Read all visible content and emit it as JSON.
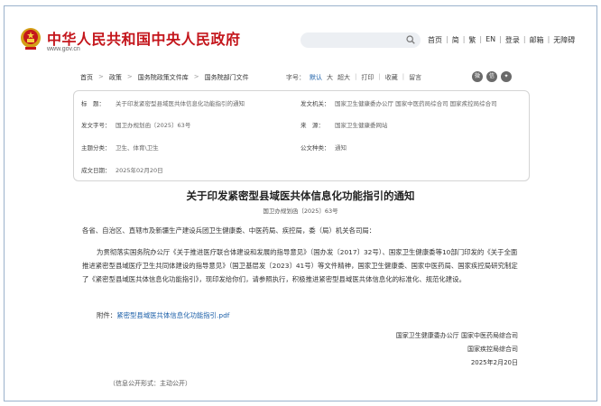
{
  "header": {
    "site_title": "中华人民共和国中央人民政府",
    "site_url": "www.gov.cn",
    "search": {
      "placeholder": ""
    },
    "nav": [
      "首页",
      "简",
      "繁",
      "EN",
      "登录",
      "邮箱",
      "无障碍"
    ]
  },
  "breadcrumb": {
    "items": [
      "首页",
      "政策",
      "国务院政策文件库",
      "国务院部门文件"
    ],
    "font_size_label": "字号：",
    "font_sizes": [
      "默认",
      "大",
      "超大"
    ],
    "print": "打印",
    "favorite": "收藏",
    "leave": "留言"
  },
  "meta": {
    "title_label": "标　题：",
    "title_value": "关于印发紧密型县域医共体信息化功能指引的通知",
    "issuer_label": "发文机关：",
    "issuer_value": "国家卫生健康委办公厅  国家中医药局综合司  国家疾控局综合司",
    "docno_label": "发文字号：",
    "docno_value": "国卫办规划函〔2025〕63号",
    "source_label": "来　源：",
    "source_value": "国家卫生健康委网站",
    "topic_label": "主题分类：",
    "topic_value": "卫生、体育\\卫生",
    "type_label": "公文种类：",
    "type_value": "通知",
    "date_label": "成文日期：",
    "date_value": "2025年02月20日"
  },
  "article": {
    "title": "关于印发紧密型县域医共体信息化功能指引的通知",
    "docno": "国卫办规划函〔2025〕63号",
    "salutation": "各省、自治区、直辖市及新疆生产建设兵团卫生健康委、中医药局、疾控局，委（局）机关各司局：",
    "body": "为贯彻落实国务院办公厅《关于推进医疗联合体建设和发展的指导意见》（国办发〔2017〕32号）、国家卫生健康委等10部门印发的《关于全面推进紧密型县域医疗卫生共同体建设的指导意见》（国卫基层发〔2023〕41号）等文件精神，国家卫生健康委、国家中医药局、国家疾控局研究制定了《紧密型县域医共体信息化功能指引》，现印发给你们，请参照执行，积极推进紧密型县域医共体信息化的标准化、规范化建设。",
    "attachment_label": "附件：",
    "attachment_link": "紧密型县域医共体信息化功能指引.pdf",
    "signers": [
      "国家卫生健康委办公厅  国家中医药局综合司",
      "国家疾控局综合司",
      "2025年2月20日"
    ],
    "disclosure": "（信息公开形式：主动公开）"
  }
}
